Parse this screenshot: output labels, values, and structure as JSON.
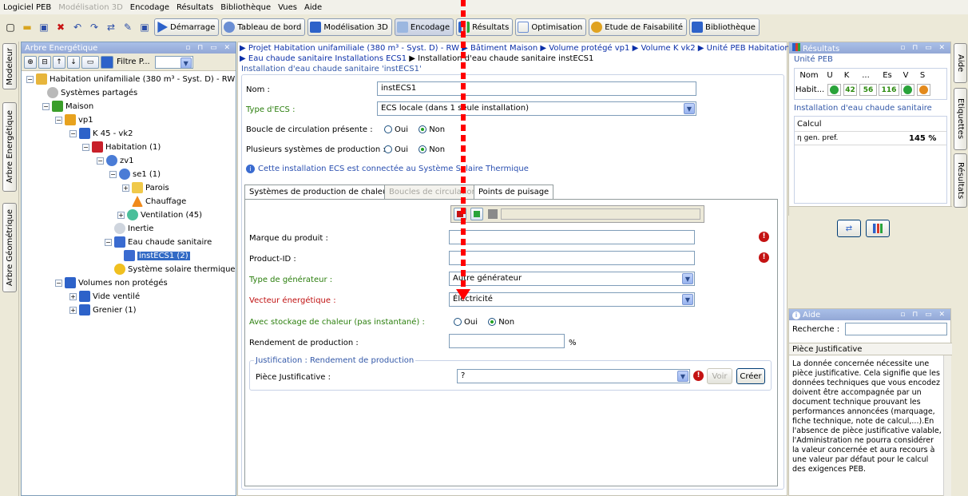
{
  "menu": {
    "app": "Logiciel PEB",
    "modelisation": "Modélisation 3D",
    "encodage": "Encodage",
    "resultats": "Résultats",
    "bibliotheque": "Bibliothèque",
    "vues": "Vues",
    "aide": "Aide"
  },
  "toolbar": {
    "demarrage": "Démarrage",
    "tableau": "Tableau de bord",
    "modelisation": "Modélisation 3D",
    "encodage": "Encodage",
    "resultats": "Résultats",
    "optimisation": "Optimisation",
    "faisabilite": "Etude de Faisabilité",
    "bibliotheque": "Bibliothèque"
  },
  "left_tabs": {
    "modeleur": "Modeleur",
    "arbre_energetique": "Arbre Energétique",
    "arbre_geometrique": "Arbre Géométrique"
  },
  "tree": {
    "title": "Arbre Energétique",
    "filter": "Filtre P...",
    "items": [
      "Habitation unifamiliale (380 m³ - Syst. D) - RW (",
      "Systèmes partagés",
      "Maison",
      "vp1",
      "K 45 - vk2",
      "Habitation (1)",
      "zv1",
      "se1 (1)",
      "Parois",
      "Chauffage",
      "Ventilation (45)",
      "Inertie",
      "Eau chaude sanitaire",
      "instECS1 (2)",
      "Système solaire thermique",
      "Volumes non protégés",
      "Vide ventilé",
      "Grenier (1)"
    ]
  },
  "breadcrumb": {
    "line1": "▶ Projet Habitation unifamiliale (380 m³ - Syst. D) - RW ▶ Bâtiment Maison ▶ Volume protégé vp1 ▶ Volume K vk2 ▶ Unité PEB Habitation",
    "line2a": "▶ Eau chaude sanitaire Installations ECS1",
    "line2b": " ▶ Installation d'eau chaude sanitaire instECS1"
  },
  "form": {
    "group_title": "Installation d'eau chaude sanitaire 'instECS1'",
    "nom_label": "Nom :",
    "nom_value": "instECS1",
    "type_label": "Type d'ECS :",
    "type_value": "ECS locale (dans 1 seule installation)",
    "boucle_label": "Boucle de circulation présente :",
    "plusieurs_label": "Plusieurs systèmes de production :",
    "oui": "Oui",
    "non": "Non",
    "info": "Cette installation ECS est connectée au Système Solaire Thermique"
  },
  "tabs": {
    "t1": "Systèmes de production de chaleur",
    "t2": "Boucles de circulation",
    "t3": "Points de puisage"
  },
  "prod": {
    "marque_label": "Marque du produit :",
    "product_label": "Product-ID :",
    "type_gen_label": "Type de générateur :",
    "type_gen_value": "Autre générateur",
    "vecteur_label": "Vecteur énergétique :",
    "vecteur_value": "Électricité",
    "stockage_label": "Avec stockage de chaleur (pas instantané) :",
    "rendement_label": "Rendement de production :",
    "percent": "%",
    "justif_title": "Justification : Rendement de production",
    "piece_label": "Pièce Justificative :",
    "piece_value": "?",
    "voir": "Voir",
    "creer": "Créer"
  },
  "results": {
    "title": "Résultats",
    "unite": "Unité PEB",
    "cols": [
      "Nom",
      "U",
      "K",
      "...",
      "Es",
      "V",
      "S"
    ],
    "row_name": "Habit...",
    "k": "42",
    "dots": "56",
    "es": "116",
    "install_title": "Installation d'eau chaude sanitaire",
    "calcul": "Calcul",
    "metric": "η gen. pref.",
    "metric_value": "145 %"
  },
  "aide": {
    "title": "Aide",
    "recherche": "Recherche :",
    "heading": "Pièce Justificative",
    "text": "La donnée concernée nécessite une pièce justificative. Cela signifie que les données techniques que vous encodez doivent être accompagnée par un document technique prouvant les performances annoncées (marquage, fiche technique, note de calcul,...).En l'absence de pièce justificative valable, l'Administration ne pourra considérer la valeur concernée et aura recours à une valeur par défaut pour le calcul des exigences PEB."
  },
  "right_tabs": {
    "aide": "Aide",
    "etiquettes": "Etiquettes",
    "resultats": "Résultats"
  },
  "colors": {
    "accent": "#316ac5",
    "error": "#c41212",
    "green_label": "#2a7e0c",
    "red_label": "#c01010",
    "annotation": "#ff0000"
  }
}
